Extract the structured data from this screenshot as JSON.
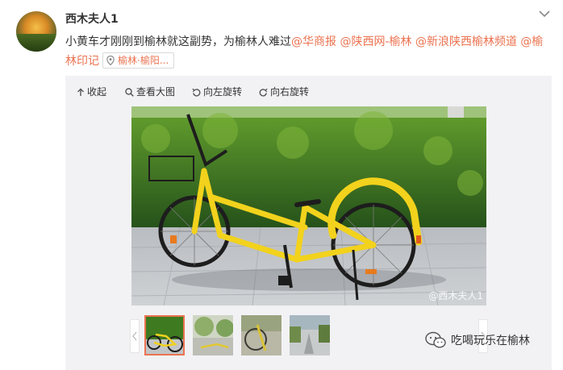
{
  "post": {
    "author": "西木夫人1",
    "text_lead": "小黄车才刚刚到榆林就这副势，为榆林人难过",
    "mentions": [
      "@华商报",
      "@陕西网-榆林",
      "@新浪陕西榆林频道",
      "@榆",
      "林印记"
    ],
    "location": "榆林·榆阳..."
  },
  "media_toolbar": {
    "collapse": "收起",
    "view_large": "查看大图",
    "rotate_left": "向左旋转",
    "rotate_right": "向右旋转"
  },
  "photo": {
    "watermark": "@西木夫人1"
  },
  "thumbnails": [
    {
      "name": "thumb-1",
      "selected": true
    },
    {
      "name": "thumb-2",
      "selected": false
    },
    {
      "name": "thumb-3",
      "selected": false
    },
    {
      "name": "thumb-4",
      "selected": false
    }
  ],
  "footer": {
    "wechat_label": "吃喝玩乐在榆林"
  },
  "icons": [
    "chevron-down-icon",
    "location-pin-icon",
    "collapse-arrow-icon",
    "magnifier-icon",
    "rotate-left-icon",
    "rotate-right-icon",
    "wechat-icon"
  ],
  "colors": {
    "link": "#eb7350",
    "bike_yellow": "#f2d21c",
    "hedge_green": "#3c7a1e"
  }
}
